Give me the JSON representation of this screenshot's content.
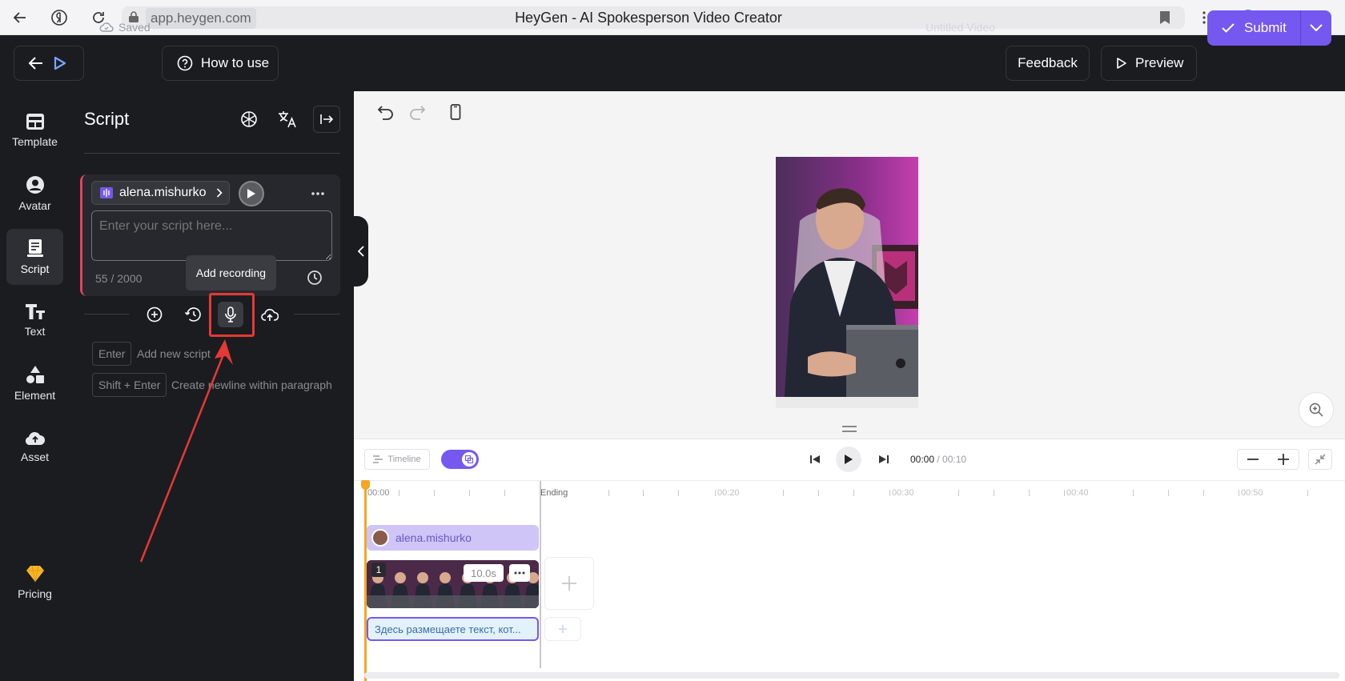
{
  "browser": {
    "url": "app.heygen.com",
    "title": "HeyGen - AI Spokesperson Video Creator"
  },
  "header": {
    "saved": "Saved",
    "how_to_use": "How to use",
    "video_name": "Untitled Video",
    "feedback": "Feedback",
    "preview": "Preview",
    "submit": "Submit"
  },
  "rail": {
    "items": [
      {
        "label": "Template",
        "icon": "template-icon"
      },
      {
        "label": "Avatar",
        "icon": "avatar-icon"
      },
      {
        "label": "Script",
        "icon": "script-icon"
      },
      {
        "label": "Text",
        "icon": "text-icon"
      },
      {
        "label": "Element",
        "icon": "element-icon"
      },
      {
        "label": "Asset",
        "icon": "asset-icon"
      }
    ],
    "pricing": "Pricing"
  },
  "script_panel": {
    "title": "Script",
    "voice_name": "alena.mishurko",
    "placeholder": "Enter your script here...",
    "char_count": "55 / 2000",
    "tooltip": "Add recording",
    "shortcuts": [
      {
        "key": "Enter",
        "desc": "Add new script"
      },
      {
        "key": "Shift + Enter",
        "desc": "Create newline within paragraph"
      }
    ]
  },
  "timeline": {
    "label": "Timeline",
    "current_time": "00:00",
    "total_time": " / 00:10",
    "ruler": [
      "00:00",
      "Ending",
      "00:20",
      "00:30",
      "00:40",
      "00:50"
    ],
    "avatar_track": "alena.mishurko",
    "scene_number": "1",
    "scene_duration": "10.0s",
    "text_track": "Здесь размещаете текст, кот..."
  },
  "colors": {
    "accent": "#7458f0",
    "highlight": "#e53935",
    "dark_bg": "#1b1c20"
  }
}
